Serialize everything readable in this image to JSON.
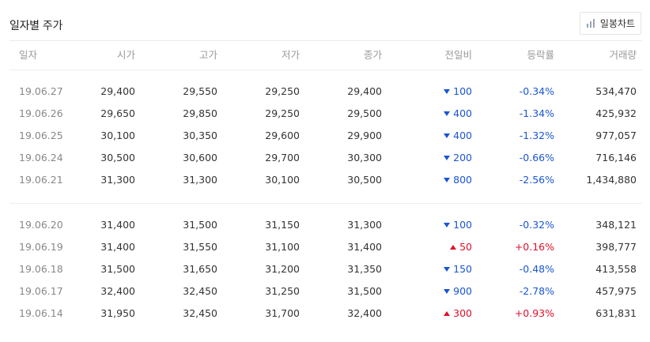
{
  "title": "일자별 주가",
  "chart_button": {
    "label": "일봉차트",
    "icon": "bar-chart-icon"
  },
  "columns": [
    "일자",
    "시가",
    "고가",
    "저가",
    "종가",
    "전일비",
    "등락률",
    "거래량"
  ],
  "colors": {
    "down": "#1a56d3",
    "up": "#e0102b"
  },
  "groups": [
    [
      {
        "date": "19.06.27",
        "open": "29,400",
        "high": "29,550",
        "low": "29,250",
        "close": "29,400",
        "dir": "down",
        "change": "100",
        "rate": "-0.34%",
        "volume": "534,470"
      },
      {
        "date": "19.06.26",
        "open": "29,650",
        "high": "29,850",
        "low": "29,250",
        "close": "29,500",
        "dir": "down",
        "change": "400",
        "rate": "-1.34%",
        "volume": "425,932"
      },
      {
        "date": "19.06.25",
        "open": "30,100",
        "high": "30,350",
        "low": "29,600",
        "close": "29,900",
        "dir": "down",
        "change": "400",
        "rate": "-1.32%",
        "volume": "977,057"
      },
      {
        "date": "19.06.24",
        "open": "30,500",
        "high": "30,600",
        "low": "29,700",
        "close": "30,300",
        "dir": "down",
        "change": "200",
        "rate": "-0.66%",
        "volume": "716,146"
      },
      {
        "date": "19.06.21",
        "open": "31,300",
        "high": "31,300",
        "low": "30,100",
        "close": "30,500",
        "dir": "down",
        "change": "800",
        "rate": "-2.56%",
        "volume": "1,434,880"
      }
    ],
    [
      {
        "date": "19.06.20",
        "open": "31,400",
        "high": "31,500",
        "low": "31,150",
        "close": "31,300",
        "dir": "down",
        "change": "100",
        "rate": "-0.32%",
        "volume": "348,121"
      },
      {
        "date": "19.06.19",
        "open": "31,400",
        "high": "31,550",
        "low": "31,100",
        "close": "31,400",
        "dir": "up",
        "change": "50",
        "rate": "+0.16%",
        "volume": "398,777"
      },
      {
        "date": "19.06.18",
        "open": "31,500",
        "high": "31,650",
        "low": "31,200",
        "close": "31,350",
        "dir": "down",
        "change": "150",
        "rate": "-0.48%",
        "volume": "413,558"
      },
      {
        "date": "19.06.17",
        "open": "32,400",
        "high": "32,450",
        "low": "31,250",
        "close": "31,500",
        "dir": "down",
        "change": "900",
        "rate": "-2.78%",
        "volume": "457,975"
      },
      {
        "date": "19.06.14",
        "open": "31,950",
        "high": "32,450",
        "low": "31,700",
        "close": "32,400",
        "dir": "up",
        "change": "300",
        "rate": "+0.93%",
        "volume": "631,831"
      }
    ]
  ]
}
